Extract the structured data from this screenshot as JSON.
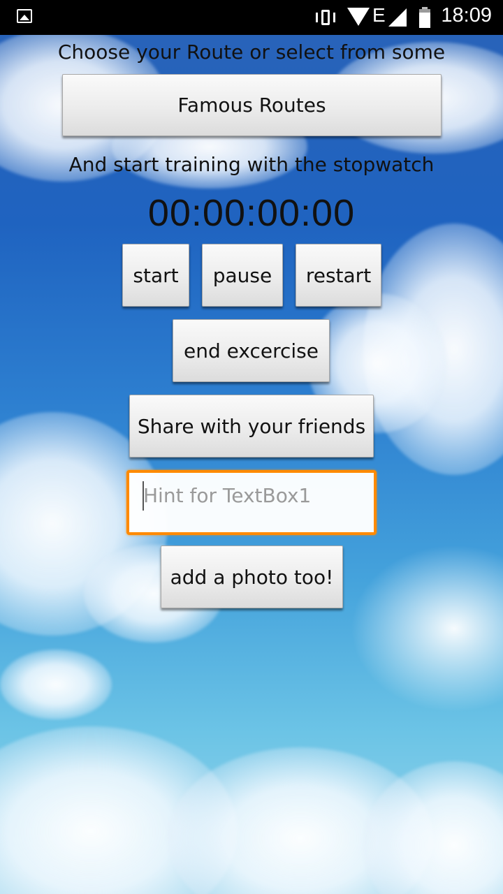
{
  "status_bar": {
    "network_type": "E",
    "time": "18:09",
    "battery_level": 0.8
  },
  "main": {
    "intro_text": "Choose your Route or select from some",
    "famous_routes_label": "Famous Routes",
    "training_text": "And start training with the stopwatch",
    "stopwatch": "00:00:00:00",
    "start_label": "start",
    "pause_label": "pause",
    "restart_label": "restart",
    "end_label": "end excercise",
    "share_label": "Share with your friends",
    "text_input": {
      "value": "",
      "placeholder": "Hint for TextBox1"
    },
    "photo_label": "add a photo too!"
  },
  "colors": {
    "input_focus_border": "#ff8a00",
    "status_bar_bg": "#000000"
  }
}
